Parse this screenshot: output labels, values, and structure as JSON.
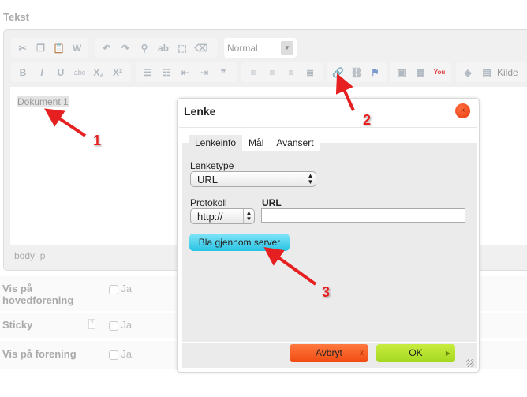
{
  "field_label": "Tekst",
  "toolbar": {
    "format_value": "Normal",
    "source_label": "Kilde",
    "row1": [
      "cut-icon",
      "copy-icon",
      "paste-icon",
      "paste-word-icon",
      "undo-icon",
      "redo-icon",
      "find-icon",
      "replace-icon",
      "select-all-icon",
      "remove-format-icon"
    ],
    "row2": [
      "B",
      "I",
      "U",
      "abc",
      "X₂",
      "X²"
    ]
  },
  "editor": {
    "content": "Dokument 1",
    "path": [
      "body",
      "p"
    ]
  },
  "form_rows": [
    {
      "label": "Vis på hovedforening",
      "option": "Ja"
    },
    {
      "label": "Sticky",
      "option": "Ja",
      "help": "?"
    },
    {
      "label": "Vis på forening",
      "option": "Ja"
    }
  ],
  "dialog": {
    "title": "Lenke",
    "tabs": [
      "Lenkeinfo",
      "Mål",
      "Avansert"
    ],
    "link_type_label": "Lenketype",
    "link_type_value": "URL",
    "protocol_label": "Protokoll",
    "protocol_value": "http://",
    "url_label": "URL",
    "url_value": "",
    "browse_label": "Bla gjennom server",
    "cancel_label": "Avbryt",
    "cancel_icon": "x",
    "ok_label": "OK"
  },
  "annotations": [
    "1",
    "2",
    "3"
  ],
  "colors": {
    "arrow": "#e62020",
    "browse": "#3cc8e8",
    "cancel": "#f05a20",
    "ok": "#a8dc20",
    "close": "#e83a10"
  }
}
